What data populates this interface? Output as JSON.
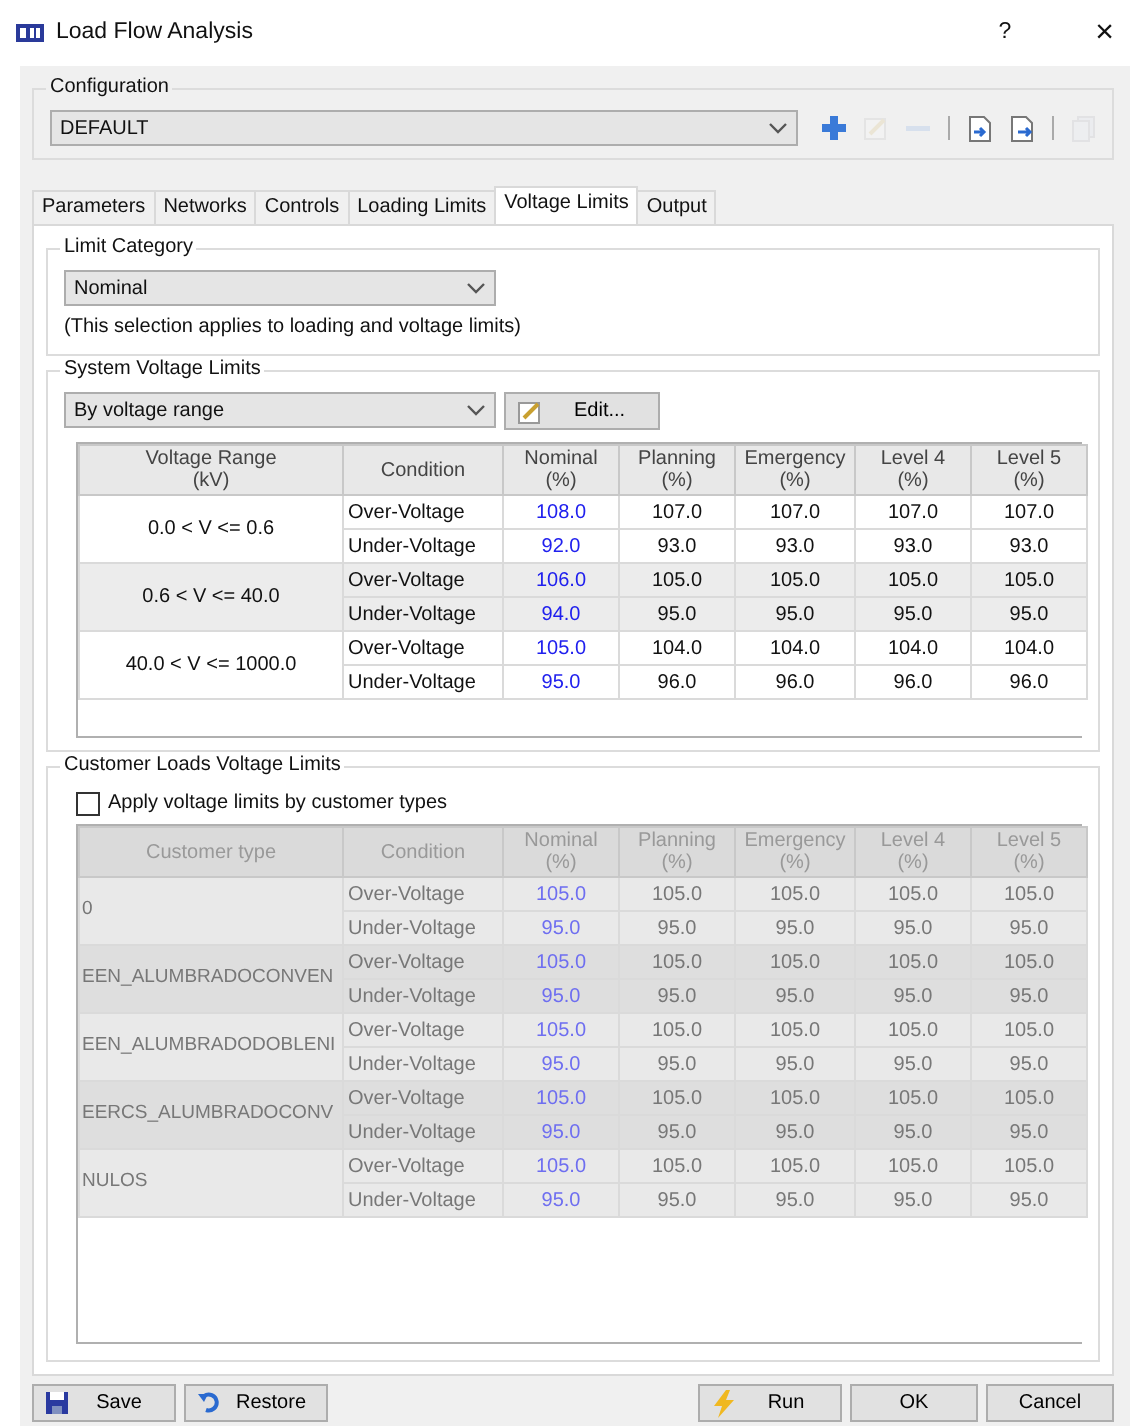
{
  "window": {
    "title": "Load Flow Analysis",
    "help": "?",
    "close": "×"
  },
  "configuration": {
    "label": "Configuration",
    "value": "DEFAULT"
  },
  "toolbar": [
    {
      "kind": "add",
      "disabled": false
    },
    {
      "kind": "edit",
      "disabled": true
    },
    {
      "kind": "remove",
      "disabled": true
    },
    {
      "kind": "separator"
    },
    {
      "kind": "import",
      "disabled": false
    },
    {
      "kind": "export",
      "disabled": false
    },
    {
      "kind": "separator"
    },
    {
      "kind": "copy",
      "disabled": true
    }
  ],
  "tabs": [
    {
      "label": "Parameters",
      "selected": false
    },
    {
      "label": "Networks",
      "selected": false
    },
    {
      "label": "Controls",
      "selected": false
    },
    {
      "label": "Loading Limits",
      "selected": false
    },
    {
      "label": "Voltage Limits",
      "selected": true
    },
    {
      "label": "Output",
      "selected": false
    }
  ],
  "limit_category": {
    "label": "Limit Category",
    "value": "Nominal",
    "note": "(This selection applies to loading and voltage limits)"
  },
  "system_voltage_limits": {
    "label": "System Voltage Limits",
    "mode": "By voltage range",
    "edit_button": "Edit...",
    "columns": [
      "Voltage Range\n(kV)",
      "Condition",
      "Nominal\n(%)",
      "Planning\n(%)",
      "Emergency\n(%)",
      "Level 4\n(%)",
      "Level 5\n(%)"
    ],
    "groups": [
      {
        "name": "0.0 < V <= 0.6",
        "rows": [
          {
            "condition": "Over-Voltage",
            "values": [
              "108.0",
              "107.0",
              "107.0",
              "107.0",
              "107.0"
            ]
          },
          {
            "condition": "Under-Voltage",
            "values": [
              "92.0",
              "93.0",
              "93.0",
              "93.0",
              "93.0"
            ]
          }
        ]
      },
      {
        "name": "0.6 < V <= 40.0",
        "rows": [
          {
            "condition": "Over-Voltage",
            "values": [
              "106.0",
              "105.0",
              "105.0",
              "105.0",
              "105.0"
            ]
          },
          {
            "condition": "Under-Voltage",
            "values": [
              "94.0",
              "95.0",
              "95.0",
              "95.0",
              "95.0"
            ]
          }
        ]
      },
      {
        "name": "40.0 < V <= 1000.0",
        "rows": [
          {
            "condition": "Over-Voltage",
            "values": [
              "105.0",
              "104.0",
              "104.0",
              "104.0",
              "104.0"
            ]
          },
          {
            "condition": "Under-Voltage",
            "values": [
              "95.0",
              "96.0",
              "96.0",
              "96.0",
              "96.0"
            ]
          }
        ]
      }
    ]
  },
  "customer_loads": {
    "label": "Customer Loads Voltage Limits",
    "checkbox": {
      "label": "Apply voltage limits by customer types",
      "checked": false
    },
    "disabled": true,
    "columns": [
      "Customer type",
      "Condition",
      "Nominal\n(%)",
      "Planning\n(%)",
      "Emergency\n(%)",
      "Level 4\n(%)",
      "Level 5\n(%)"
    ],
    "groups": [
      {
        "name": "0",
        "rows": [
          {
            "condition": "Over-Voltage",
            "values": [
              "105.0",
              "105.0",
              "105.0",
              "105.0",
              "105.0"
            ]
          },
          {
            "condition": "Under-Voltage",
            "values": [
              "95.0",
              "95.0",
              "95.0",
              "95.0",
              "95.0"
            ]
          }
        ]
      },
      {
        "name": "EEN_ALUMBRADOCONVEN",
        "rows": [
          {
            "condition": "Over-Voltage",
            "values": [
              "105.0",
              "105.0",
              "105.0",
              "105.0",
              "105.0"
            ]
          },
          {
            "condition": "Under-Voltage",
            "values": [
              "95.0",
              "95.0",
              "95.0",
              "95.0",
              "95.0"
            ]
          }
        ]
      },
      {
        "name": "EEN_ALUMBRADODOBLENI",
        "rows": [
          {
            "condition": "Over-Voltage",
            "values": [
              "105.0",
              "105.0",
              "105.0",
              "105.0",
              "105.0"
            ]
          },
          {
            "condition": "Under-Voltage",
            "values": [
              "95.0",
              "95.0",
              "95.0",
              "95.0",
              "95.0"
            ]
          }
        ]
      },
      {
        "name": "EERCS_ALUMBRADOCONV",
        "rows": [
          {
            "condition": "Over-Voltage",
            "values": [
              "105.0",
              "105.0",
              "105.0",
              "105.0",
              "105.0"
            ]
          },
          {
            "condition": "Under-Voltage",
            "values": [
              "95.0",
              "95.0",
              "95.0",
              "95.0",
              "95.0"
            ]
          }
        ]
      },
      {
        "name": "NULOS",
        "rows": [
          {
            "condition": "Over-Voltage",
            "values": [
              "105.0",
              "105.0",
              "105.0",
              "105.0",
              "105.0"
            ]
          },
          {
            "condition": "Under-Voltage",
            "values": [
              "95.0",
              "95.0",
              "95.0",
              "95.0",
              "95.0"
            ]
          }
        ]
      }
    ]
  },
  "buttons": [
    {
      "label": "Save",
      "kind": "save"
    },
    {
      "label": "Restore",
      "kind": "restore"
    },
    {
      "label": "Run",
      "kind": "run"
    },
    {
      "label": "OK",
      "kind": "plain"
    },
    {
      "label": "Cancel",
      "kind": "plain"
    }
  ]
}
